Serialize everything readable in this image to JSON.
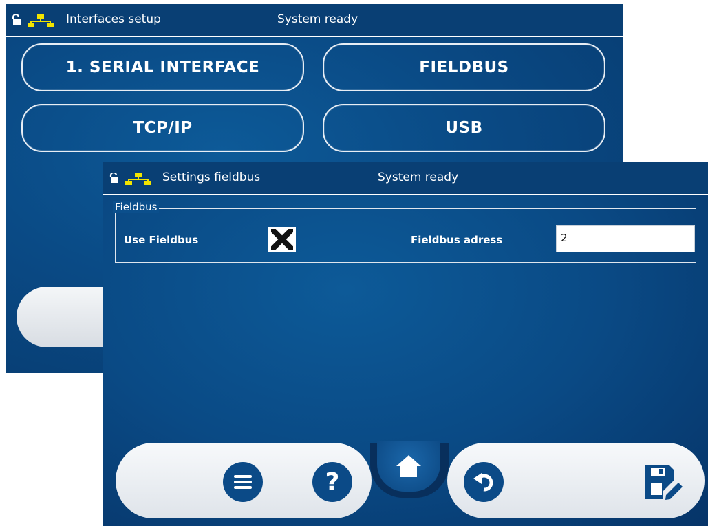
{
  "back_window": {
    "title": "Interfaces setup",
    "status": "System ready",
    "buttons": [
      {
        "label": "1. SERIAL INTERFACE"
      },
      {
        "label": "FIELDBUS"
      },
      {
        "label": "TCP/IP"
      },
      {
        "label": "USB"
      }
    ]
  },
  "front_window": {
    "title": "Settings fieldbus",
    "status": "System ready",
    "group": {
      "legend": "Fieldbus",
      "use_label": "Use Fieldbus",
      "use_checked_symbol": "✖",
      "address_label": "Fieldbus adress",
      "address_value": "2"
    }
  },
  "bottom_nav": {
    "icons": [
      "menu-icon",
      "help-icon",
      "home-icon",
      "undo-icon",
      "save-edit-icon"
    ],
    "help_symbol": "?"
  },
  "colors": {
    "screen_blue": "#0a4a85",
    "titlebar_blue": "#093f74",
    "network_icon_yellow": "#f2e400"
  }
}
